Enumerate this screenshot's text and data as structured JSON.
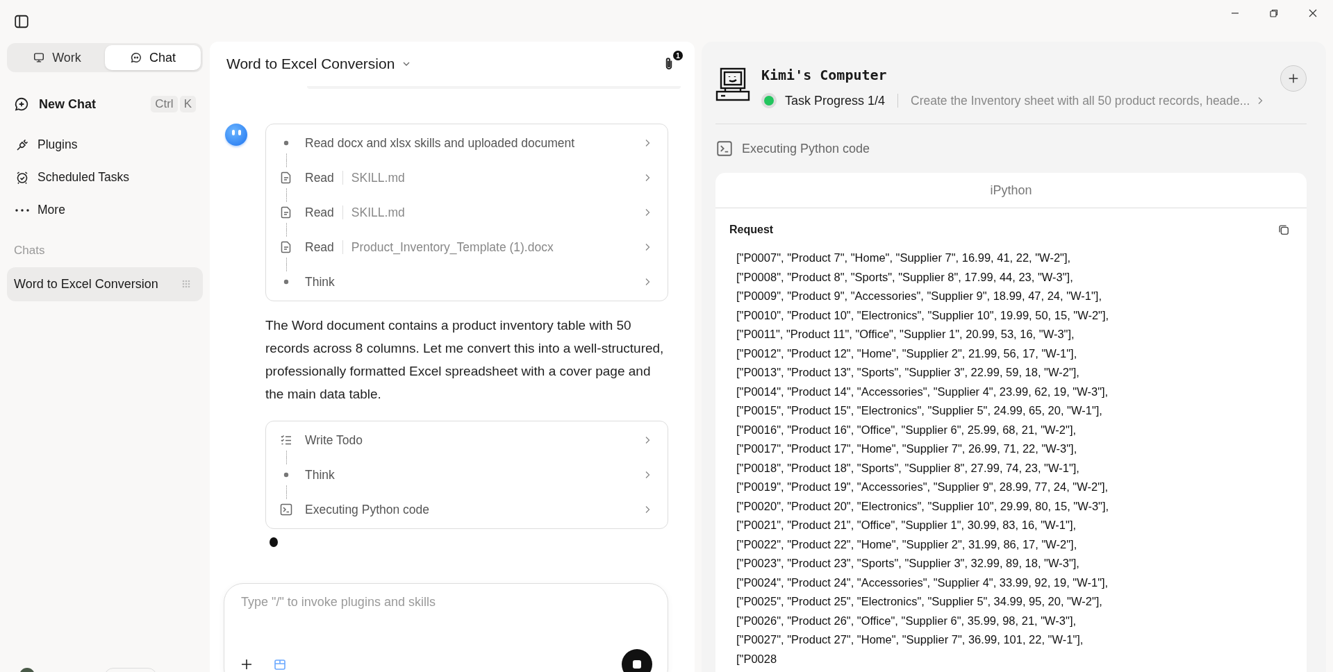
{
  "sidebar": {
    "modes": [
      {
        "label": "Work",
        "selected": false
      },
      {
        "label": "Chat",
        "selected": true
      }
    ],
    "new_chat": {
      "label": "New Chat",
      "shortcut": [
        "Ctrl",
        "K"
      ]
    },
    "nav": [
      {
        "label": "Plugins"
      },
      {
        "label": "Scheduled Tasks"
      },
      {
        "label": "More"
      }
    ],
    "section_title": "Chats",
    "chats": [
      {
        "title": "Word to Excel Conversion",
        "selected": true
      }
    ]
  },
  "chat": {
    "title": "Word to Excel Conversion",
    "attachments_badge": "1",
    "step_groups": [
      [
        {
          "kind": "task",
          "action": "Read docx and xlsx skills and uploaded document"
        },
        {
          "kind": "read",
          "action": "Read",
          "target": "SKILL.md"
        },
        {
          "kind": "read",
          "action": "Read",
          "target": "SKILL.md"
        },
        {
          "kind": "read",
          "action": "Read",
          "target": "Product_Inventory_Template (1).docx"
        },
        {
          "kind": "think",
          "action": "Think"
        }
      ],
      [
        {
          "kind": "todo",
          "action": "Write Todo"
        },
        {
          "kind": "think",
          "action": "Think"
        },
        {
          "kind": "code",
          "action": "Executing Python code"
        }
      ]
    ],
    "message": "The Word document contains a product inventory table with 50 records across 8 columns. Let me convert this into a well-structured, professionally formatted Excel spreadsheet with a cover page and the main data table.",
    "input": {
      "placeholder": "Type \"/\" to invoke plugins and skills"
    }
  },
  "computer": {
    "title": "Kimi's Computer",
    "progress": "Task Progress 1/4",
    "running": true,
    "current_task": "Create the Inventory sheet with all 50 product records, heade...",
    "activity": "Executing Python code",
    "tool": "iPython",
    "request_label": "Request",
    "code_lines": [
      "[\"P0007\", \"Product 7\", \"Home\", \"Supplier 7\", 16.99, 41, 22, \"W-2\"],",
      "[\"P0008\", \"Product 8\", \"Sports\", \"Supplier 8\", 17.99, 44, 23, \"W-3\"],",
      "[\"P0009\", \"Product 9\", \"Accessories\", \"Supplier 9\", 18.99, 47, 24, \"W-1\"],",
      "[\"P0010\", \"Product 10\", \"Electronics\", \"Supplier 10\", 19.99, 50, 15, \"W-2\"],",
      "[\"P0011\", \"Product 11\", \"Office\", \"Supplier 1\", 20.99, 53, 16, \"W-3\"],",
      "[\"P0012\", \"Product 12\", \"Home\", \"Supplier 2\", 21.99, 56, 17, \"W-1\"],",
      "[\"P0013\", \"Product 13\", \"Sports\", \"Supplier 3\", 22.99, 59, 18, \"W-2\"],",
      "[\"P0014\", \"Product 14\", \"Accessories\", \"Supplier 4\", 23.99, 62, 19, \"W-3\"],",
      "[\"P0015\", \"Product 15\", \"Electronics\", \"Supplier 5\", 24.99, 65, 20, \"W-1\"],",
      "[\"P0016\", \"Product 16\", \"Office\", \"Supplier 6\", 25.99, 68, 21, \"W-2\"],",
      "[\"P0017\", \"Product 17\", \"Home\", \"Supplier 7\", 26.99, 71, 22, \"W-3\"],",
      "[\"P0018\", \"Product 18\", \"Sports\", \"Supplier 8\", 27.99, 74, 23, \"W-1\"],",
      "[\"P0019\", \"Product 19\", \"Accessories\", \"Supplier 9\", 28.99, 77, 24, \"W-2\"],",
      "[\"P0020\", \"Product 20\", \"Electronics\", \"Supplier 10\", 29.99, 80, 15, \"W-3\"],",
      "[\"P0021\", \"Product 21\", \"Office\", \"Supplier 1\", 30.99, 83, 16, \"W-1\"],",
      "[\"P0022\", \"Product 22\", \"Home\", \"Supplier 2\", 31.99, 86, 17, \"W-2\"],",
      "[\"P0023\", \"Product 23\", \"Sports\", \"Supplier 3\", 32.99, 89, 18, \"W-3\"],",
      "[\"P0024\", \"Product 24\", \"Accessories\", \"Supplier 4\", 33.99, 92, 19, \"W-1\"],",
      "[\"P0025\", \"Product 25\", \"Electronics\", \"Supplier 5\", 34.99, 95, 20, \"W-2\"],",
      "[\"P0026\", \"Product 26\", \"Office\", \"Supplier 6\", 35.99, 98, 21, \"W-3\"],",
      "[\"P0027\", \"Product 27\", \"Home\", \"Supplier 7\", 36.99, 101, 22, \"W-1\"],",
      "[\"P0028"
    ]
  }
}
